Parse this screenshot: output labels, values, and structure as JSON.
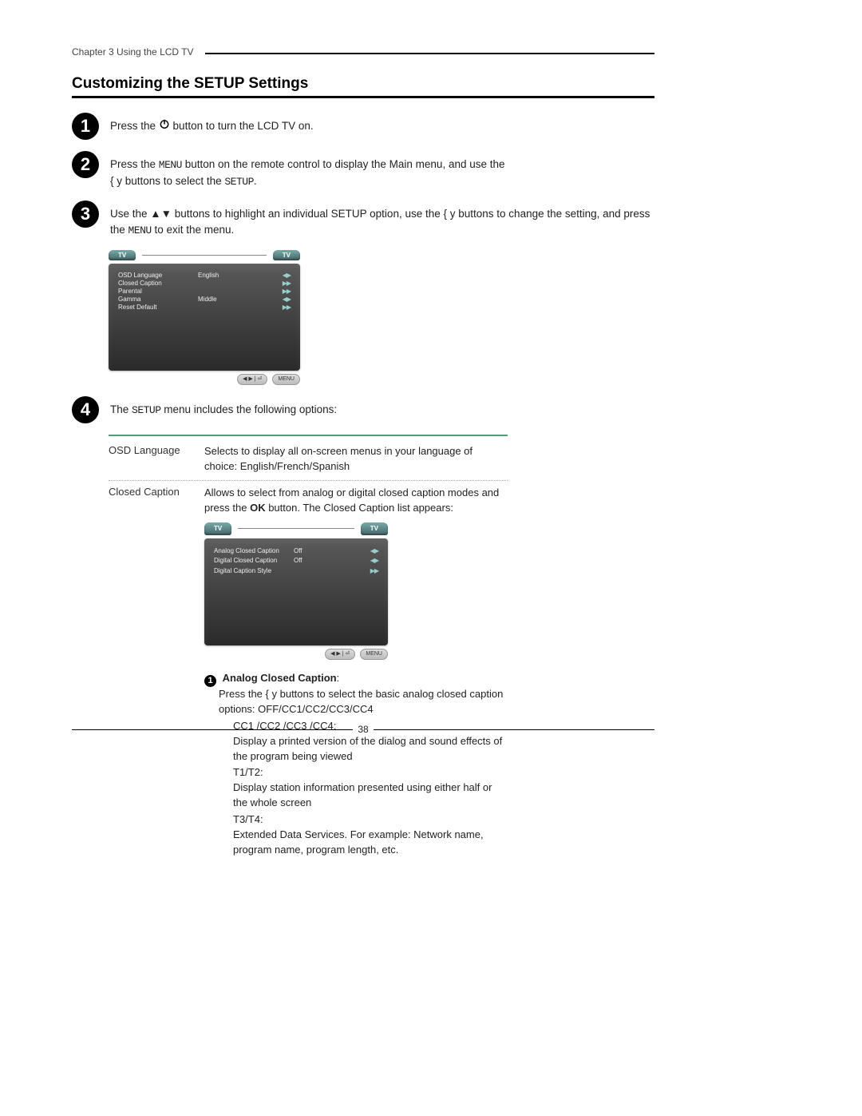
{
  "header": {
    "chapter": "Chapter 3 Using the LCD TV"
  },
  "title": "Customizing the SETUP Settings",
  "steps": {
    "s1": {
      "pre": "Press the ",
      "post": " button to turn the LCD TV on."
    },
    "s2_a": "Press the ",
    "s2_menu": "MENU",
    "s2_b": " button on the remote control to display the Main menu, and use the ",
    "s2_c": "  buttons to select the ",
    "s2_setup": "SETUP",
    "s2_end": ".",
    "s2_arrows": "{ y",
    "s3_a": "Use the ",
    "s3_b": " buttons to highlight an individual SETUP option, use the  ",
    "s3_arrows_ud": "▲▼",
    "s3_arrows_lr": "{ y",
    "s3_c": "  buttons to change the setting, and press the ",
    "s3_menu": "MENU",
    "s3_d": " to exit the menu.",
    "s4_a": "The ",
    "s4_setup": "SETUP",
    "s4_b": " menu includes the following options:"
  },
  "osd1": {
    "tab": "TV",
    "rows": [
      {
        "lbl": "OSD Language",
        "val": "English",
        "arr": "◀▶"
      },
      {
        "lbl": "Closed Caption",
        "val": "",
        "arr": "▶▶"
      },
      {
        "lbl": "Parental",
        "val": "",
        "arr": "▶▶"
      },
      {
        "lbl": "Gamma",
        "val": "Middle",
        "arr": "◀▶"
      },
      {
        "lbl": "Reset Default",
        "val": "",
        "arr": "▶▶"
      }
    ],
    "foot_nav": "◀ ▶ | ⏎",
    "foot_menu": "MENU"
  },
  "options": {
    "osd_lang": {
      "name": "OSD Language",
      "desc": "Selects to display all on-screen menus in your language of choice: English/French/Spanish"
    },
    "cc": {
      "name": "Closed Caption",
      "desc_a": "Allows to select from analog or digital closed caption modes and press the ",
      "desc_ok": "OK",
      "desc_b": " button. The Closed Caption list appears:"
    }
  },
  "osd2": {
    "tab": "TV",
    "rows": [
      {
        "lbl": "Analog Closed Caption",
        "val": "Off",
        "arr": "◀▶"
      },
      {
        "lbl": "Digital Closed Caption",
        "val": "Off",
        "arr": "◀▶"
      },
      {
        "lbl": "Digital Caption Style",
        "val": "",
        "arr": "▶▶"
      }
    ],
    "foot_nav": "◀ ▶ | ⏎",
    "foot_menu": "MENU"
  },
  "analog_cc": {
    "heading": "Analog Closed Caption",
    "l1a": "Press the ",
    "l1_arrows": "{ y",
    "l1b": "  buttons to select the basic analog closed caption options: OFF/CC1/CC2/CC3/CC4",
    "cc14_label": "CC1 /CC2 /CC3 /CC4:",
    "cc14_desc": "Display a printed version of the dialog and sound effects of the program being viewed",
    "t12_label": "T1/T2:",
    "t12_desc": "Display station information presented using either half or the whole screen",
    "t34_label": "T3/T4:",
    "t34_desc": "Extended Data Services. For example: Network name, program name, program length, etc."
  },
  "page_number": "38"
}
